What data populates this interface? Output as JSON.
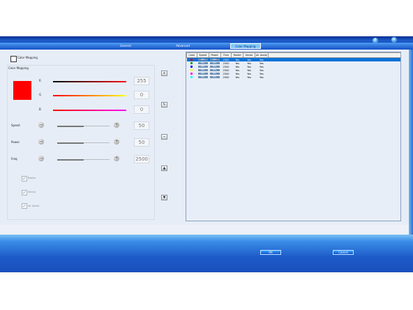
{
  "tabs": [
    {
      "label": "General",
      "active": false
    },
    {
      "label": "Advanced",
      "active": false
    },
    {
      "label": "Color Mapping",
      "active": true
    }
  ],
  "title_icons": [
    "help-icon",
    "close-icon"
  ],
  "help_glyph": "?",
  "close_glyph": "✕",
  "left": {
    "enable_checkbox_label": "Color Mapping",
    "group_label": "Color Mapping",
    "swatch_color": "#ff0000",
    "channels": [
      {
        "label": "R",
        "value": "255",
        "colors": [
          "#000000",
          "#ff0000"
        ]
      },
      {
        "label": "G",
        "value": "0",
        "colors": [
          "#ff0000",
          "#ffff00"
        ]
      },
      {
        "label": "B",
        "value": "0",
        "colors": [
          "#ff0000",
          "#ff00ff"
        ]
      }
    ],
    "params": [
      {
        "label": "Speed",
        "value": "50",
        "level": 0.5
      },
      {
        "label": "Power",
        "value": "50",
        "level": 0.5
      },
      {
        "label": "Freq",
        "value": "2500",
        "level": 0.5
      }
    ],
    "spin_minus": "−",
    "spin_plus": "+",
    "options": [
      {
        "label": "Raster",
        "checked": true
      },
      {
        "label": "Vector",
        "checked": true
      },
      {
        "label": "Air Assist",
        "checked": true
      }
    ],
    "check_glyph": "✓"
  },
  "side_buttons": [
    {
      "name": "add-button",
      "glyph": "+"
    },
    {
      "name": "edit-button",
      "glyph": "✎"
    },
    {
      "name": "delete-button",
      "glyph": "−"
    },
    {
      "name": "move-up-button",
      "glyph": "▲"
    },
    {
      "name": "move-down-button",
      "glyph": "▼"
    }
  ],
  "table": {
    "headers": [
      "Color",
      "Speed",
      "Power",
      "Freq",
      "Raster",
      "Vector",
      "Air Assist"
    ],
    "rows": [
      {
        "color": "#ff0000",
        "speed": "50%",
        "power": "50%",
        "freq": "2500",
        "raster": "Yes",
        "vector": "Yes",
        "air": "Yes",
        "selected": true
      },
      {
        "color": "#00a000",
        "speed": "50%",
        "power": "50%",
        "freq": "2500",
        "raster": "Yes",
        "vector": "Yes",
        "air": "Yes",
        "selected": false
      },
      {
        "color": "#0000ff",
        "speed": "50%",
        "power": "50%",
        "freq": "2500",
        "raster": "Yes",
        "vector": "Yes",
        "air": "Yes",
        "selected": false
      },
      {
        "color": "#ffff00",
        "speed": "50%",
        "power": "50%",
        "freq": "2500",
        "raster": "Yes",
        "vector": "Yes",
        "air": "Yes",
        "selected": false
      },
      {
        "color": "#ff00ff",
        "speed": "50%",
        "power": "50%",
        "freq": "2500",
        "raster": "Yes",
        "vector": "Yes",
        "air": "Yes",
        "selected": false
      },
      {
        "color": "#00ffff",
        "speed": "50%",
        "power": "50%",
        "freq": "2500",
        "raster": "Yes",
        "vector": "Yes",
        "air": "Yes",
        "selected": false
      }
    ]
  },
  "footer": {
    "ok_label": "OK",
    "cancel_label": "Cancel"
  },
  "colors": {
    "accent": "#1d5bc8",
    "selection": "#0a72d8",
    "panel": "#e7edf6"
  }
}
